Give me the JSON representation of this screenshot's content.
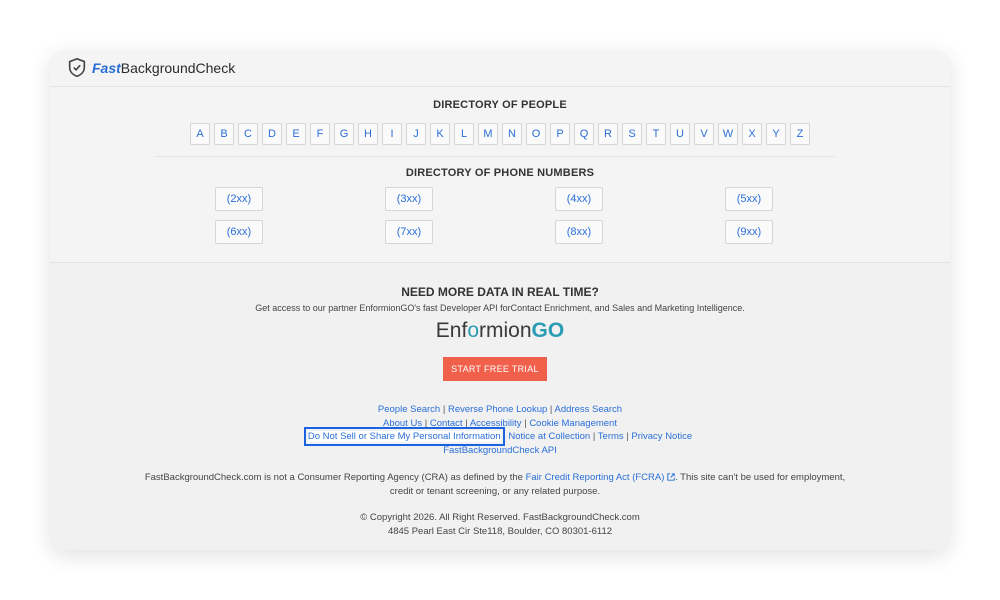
{
  "header": {
    "logo_fast": "Fast",
    "logo_rest": "BackgroundCheck"
  },
  "people_directory": {
    "title": "DIRECTORY OF PEOPLE",
    "letters": [
      "A",
      "B",
      "C",
      "D",
      "E",
      "F",
      "G",
      "H",
      "I",
      "J",
      "K",
      "L",
      "M",
      "N",
      "O",
      "P",
      "Q",
      "R",
      "S",
      "T",
      "U",
      "V",
      "W",
      "X",
      "Y",
      "Z"
    ]
  },
  "phone_directory": {
    "title": "DIRECTORY OF PHONE NUMBERS",
    "prefixes": [
      "(2xx)",
      "(3xx)",
      "(4xx)",
      "(5xx)",
      "(6xx)",
      "(7xx)",
      "(8xx)",
      "(9xx)"
    ]
  },
  "promo": {
    "heading": "NEED MORE DATA IN REAL TIME?",
    "text": "Get access to our partner EnformionGO's fast Developer API forContact Enrichment, and Sales and Marketing Intelligence.",
    "brand_part1": "Enf",
    "brand_o": "o",
    "brand_part2": "rmion",
    "brand_go": "GO",
    "cta": "START FREE TRIAL"
  },
  "footer_links": {
    "row1": [
      "People Search",
      "Reverse Phone Lookup",
      "Address Search"
    ],
    "row2": [
      "About Us",
      "Contact",
      "Accessibility",
      "Cookie Management"
    ],
    "row3": [
      "Do Not Sell or Share My Personal Information",
      "Notice at Collection",
      "Terms",
      "Privacy Notice"
    ],
    "row4": [
      "FastBackgroundCheck API"
    ]
  },
  "disclaimer": {
    "before": "FastBackgroundCheck.com is not a Consumer Reporting Agency (CRA) as defined by the ",
    "link": "Fair Credit Reporting Act (FCRA)",
    "after": ". This site can't be used for employment, credit or tenant screening, or any related purpose."
  },
  "copyright": {
    "line1": "© Copyright 2026. All Right Reserved. FastBackgroundCheck.com",
    "line2": "4845 Pearl East Cir Ste118, Boulder, CO 80301-6112"
  },
  "colors": {
    "link": "#2a6fd8",
    "cta": "#f0604b",
    "highlight": "#1a63e0",
    "brand_teal": "#2a9db5"
  }
}
